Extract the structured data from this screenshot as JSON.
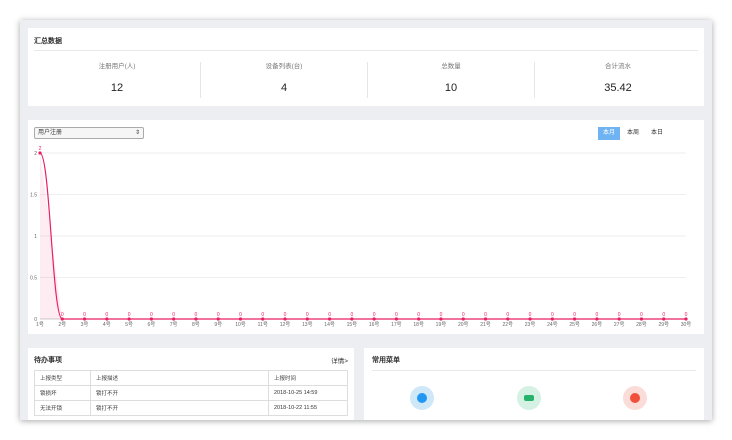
{
  "summary": {
    "title": "汇总数据",
    "stats": [
      {
        "label": "注册用户(人)",
        "value": "12"
      },
      {
        "label": "设备列表(台)",
        "value": "4"
      },
      {
        "label": "总数量",
        "value": "10"
      },
      {
        "label": "合计流水",
        "value": "35.42"
      }
    ]
  },
  "chart_panel": {
    "select_value": "用户注册",
    "range_buttons": [
      {
        "label": "本月",
        "active": true
      },
      {
        "label": "本周",
        "active": false
      },
      {
        "label": "本日",
        "active": false
      }
    ]
  },
  "chart_data": {
    "type": "line",
    "x": [
      "1号",
      "2号",
      "3号",
      "4号",
      "5号",
      "6号",
      "7号",
      "8号",
      "9号",
      "10号",
      "11号",
      "12号",
      "13号",
      "14号",
      "15号",
      "16号",
      "17号",
      "18号",
      "19号",
      "20号",
      "21号",
      "22号",
      "23号",
      "24号",
      "25号",
      "26号",
      "27号",
      "28号",
      "29号",
      "30号"
    ],
    "series": [
      {
        "values": [
          2,
          0,
          0,
          0,
          0,
          0,
          0,
          0,
          0,
          0,
          0,
          0,
          0,
          0,
          0,
          0,
          0,
          0,
          0,
          0,
          0,
          0,
          0,
          0,
          0,
          0,
          0,
          0,
          0,
          0
        ]
      }
    ],
    "yticks": [
      "0",
      "0.5",
      "1",
      "1.5",
      "2"
    ],
    "ylim": [
      0,
      2
    ],
    "grid": true,
    "data_labels": true,
    "color": "#e91e63"
  },
  "todo": {
    "title": "待办事项",
    "more": "详情>",
    "columns": [
      "上报类型",
      "上报描述",
      "上报时间"
    ],
    "rows": [
      [
        "锁损坏",
        "锁打不开",
        "2018-10-25 14:59"
      ],
      [
        "无法开锁",
        "锁打不开",
        "2018-10-22 11:55"
      ]
    ]
  },
  "menu": {
    "title": "常用菜单",
    "icons": [
      {
        "name": "list-icon",
        "color": "#cfe8f8",
        "inner": "#2196f3"
      },
      {
        "name": "car-icon",
        "color": "#d4f1e3",
        "inner": "#26b26a"
      },
      {
        "name": "money-icon",
        "color": "#fadcd8",
        "inner": "#f0503c"
      }
    ]
  }
}
